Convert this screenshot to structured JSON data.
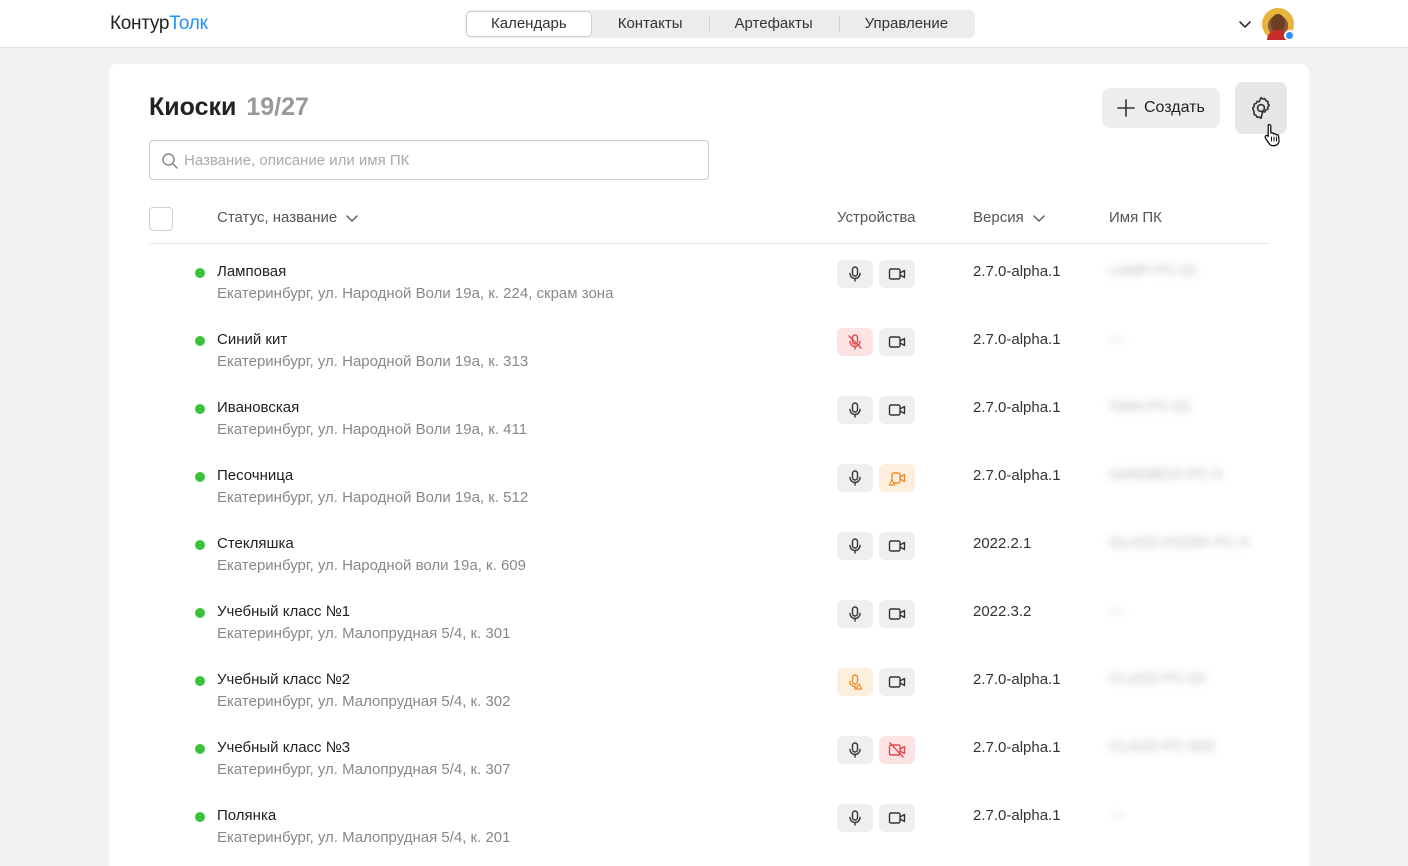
{
  "app": {
    "logo_part1": "Контур",
    "logo_part2": "Толк",
    "nav_tabs": [
      {
        "label": "Календарь",
        "active": true
      },
      {
        "label": "Контакты",
        "active": false
      },
      {
        "label": "Артефакты",
        "active": false
      },
      {
        "label": "Управление",
        "active": false
      }
    ]
  },
  "page": {
    "title": "Киоски",
    "count": "19/27",
    "create_label": "Создать",
    "search_placeholder": "Название, описание или имя ПК",
    "search_value": ""
  },
  "table": {
    "columns": {
      "status_name": "Статус, название",
      "devices": "Устройства",
      "version": "Версия",
      "pc_name": "Имя ПК"
    },
    "rows": [
      {
        "name": "Ламповая",
        "address": "Екатеринбург, ул. Народной Воли 19а, к. 224, скрам зона",
        "mic": "ok",
        "cam": "ok",
        "version": "2.7.0-alpha.1",
        "pc": "LAMP-PC-01"
      },
      {
        "name": "Синий кит",
        "address": "Екатеринбург, ул. Народной Воли 19а, к. 313",
        "mic": "off",
        "cam": "ok",
        "version": "2.7.0-alpha.1",
        "pc": "—"
      },
      {
        "name": "Ивановская",
        "address": "Екатеринбург, ул. Народной Воли 19а, к. 411",
        "mic": "ok",
        "cam": "ok",
        "version": "2.7.0-alpha.1",
        "pc": "IVAN-PC-02"
      },
      {
        "name": "Песочница",
        "address": "Екатеринбург, ул. Народной Воли 19а, к. 512",
        "mic": "ok",
        "cam": "warn",
        "version": "2.7.0-alpha.1",
        "pc": "SANDBOX-PC-3"
      },
      {
        "name": "Стекляшка",
        "address": "Екатеринбург, ул. Народной воли 19а, к. 609",
        "mic": "ok",
        "cam": "ok",
        "version": "2022.2.1",
        "pc": "GLASS-KIOSK-PC-4"
      },
      {
        "name": "Учебный класс №1",
        "address": "Екатеринбург, ул. Малопрудная 5/4, к. 301",
        "mic": "ok",
        "cam": "ok",
        "version": "2022.3.2",
        "pc": "—"
      },
      {
        "name": "Учебный класс №2",
        "address": "Екатеринбург, ул. Малопрудная 5/4, к. 302",
        "mic": "warn",
        "cam": "ok",
        "version": "2.7.0-alpha.1",
        "pc": "CLASS-PC-02"
      },
      {
        "name": "Учебный класс №3",
        "address": "Екатеринбург, ул. Малопрудная 5/4, к. 307",
        "mic": "ok",
        "cam": "off",
        "version": "2.7.0-alpha.1",
        "pc": "CLASS-PC-003"
      },
      {
        "name": "Полянка",
        "address": "Екатеринбург, ул. Малопрудная 5/4, к. 201",
        "mic": "ok",
        "cam": "ok",
        "version": "2.7.0-alpha.1",
        "pc": "—"
      }
    ]
  },
  "colors": {
    "accent": "#2291ff",
    "status_online": "#3ac23a",
    "device_error": "#e2494a",
    "device_warning": "#ef8b2c"
  }
}
